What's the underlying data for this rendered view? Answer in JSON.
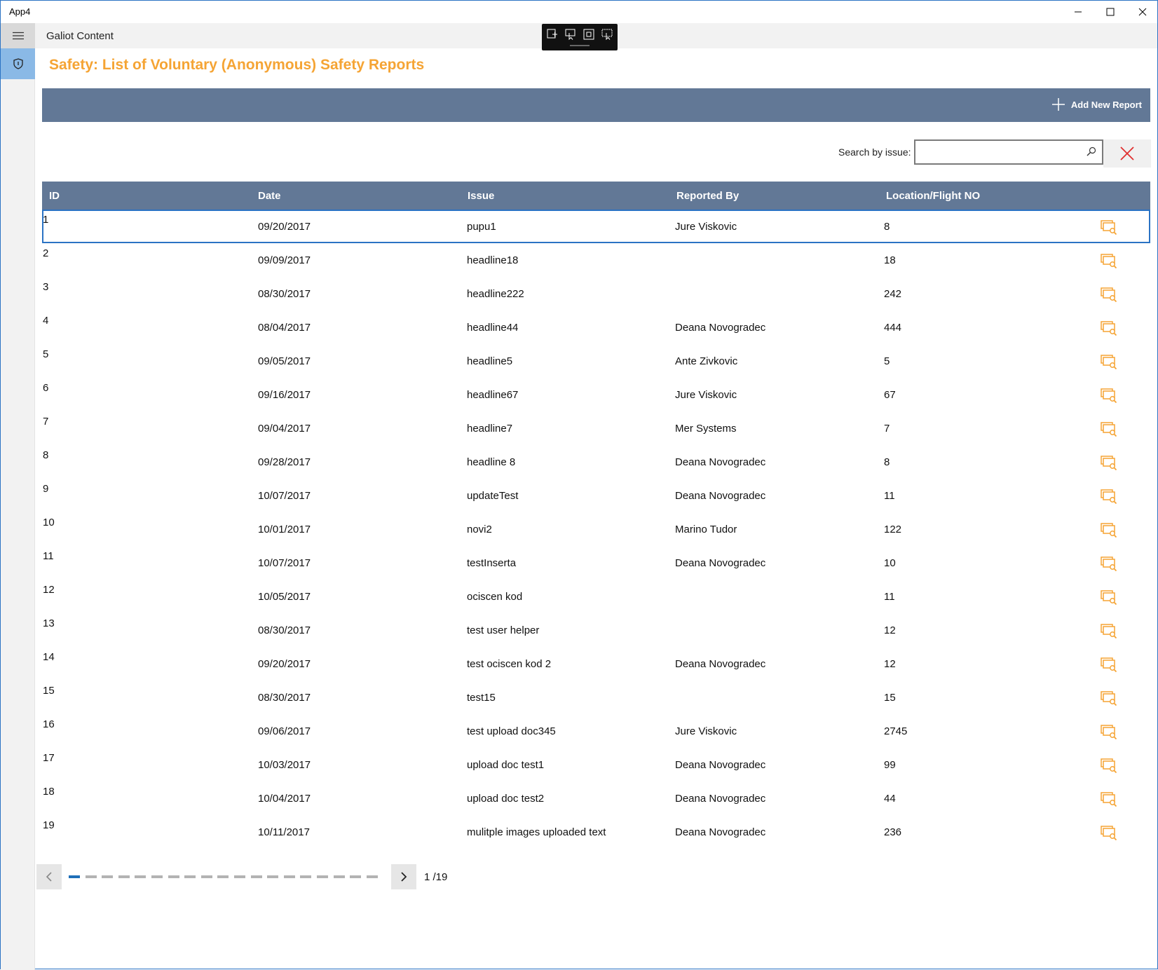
{
  "window": {
    "title": "App4"
  },
  "app": {
    "name": "Galiot Content"
  },
  "page": {
    "title": "Safety: List of Voluntary (Anonymous) Safety Reports"
  },
  "toolbar": {
    "add_label": "Add New Report"
  },
  "search": {
    "label": "Search by issue:",
    "value": ""
  },
  "table": {
    "headers": {
      "id": "ID",
      "date": "Date",
      "issue": "Issue",
      "reported_by": "Reported By",
      "location": "Location/Flight NO"
    },
    "rows": [
      {
        "id": "1",
        "date": "09/20/2017",
        "issue": "pupu1",
        "reported_by": "Jure Viskovic",
        "location": "8"
      },
      {
        "id": "2",
        "date": "09/09/2017",
        "issue": "headline18",
        "reported_by": "",
        "location": "18"
      },
      {
        "id": "3",
        "date": "08/30/2017",
        "issue": "headline222",
        "reported_by": "",
        "location": "242"
      },
      {
        "id": "4",
        "date": "08/04/2017",
        "issue": "headline44",
        "reported_by": "Deana Novogradec",
        "location": "444"
      },
      {
        "id": "5",
        "date": "09/05/2017",
        "issue": "headline5",
        "reported_by": "Ante Zivkovic",
        "location": "5"
      },
      {
        "id": "6",
        "date": "09/16/2017",
        "issue": "headline67",
        "reported_by": "Jure Viskovic",
        "location": "67"
      },
      {
        "id": "7",
        "date": "09/04/2017",
        "issue": "headline7",
        "reported_by": "Mer Systems",
        "location": "7"
      },
      {
        "id": "8",
        "date": "09/28/2017",
        "issue": "headline 8",
        "reported_by": "Deana Novogradec",
        "location": "8"
      },
      {
        "id": "9",
        "date": "10/07/2017",
        "issue": "updateTest",
        "reported_by": "Deana Novogradec",
        "location": "11"
      },
      {
        "id": "10",
        "date": "10/01/2017",
        "issue": "novi2",
        "reported_by": "Marino Tudor",
        "location": "122"
      },
      {
        "id": "11",
        "date": "10/07/2017",
        "issue": "testInserta",
        "reported_by": "Deana Novogradec",
        "location": "10"
      },
      {
        "id": "12",
        "date": "10/05/2017",
        "issue": "ociscen kod",
        "reported_by": "",
        "location": "11"
      },
      {
        "id": "13",
        "date": "08/30/2017",
        "issue": "test user helper",
        "reported_by": "",
        "location": "12"
      },
      {
        "id": "14",
        "date": "09/20/2017",
        "issue": "test ociscen kod 2",
        "reported_by": "Deana Novogradec",
        "location": "12"
      },
      {
        "id": "15",
        "date": "08/30/2017",
        "issue": "test15",
        "reported_by": "",
        "location": "15"
      },
      {
        "id": "16",
        "date": "09/06/2017",
        "issue": "test upload doc345",
        "reported_by": "Jure Viskovic",
        "location": "2745"
      },
      {
        "id": "17",
        "date": "10/03/2017",
        "issue": "upload doc test1",
        "reported_by": "Deana Novogradec",
        "location": "99"
      },
      {
        "id": "18",
        "date": "10/04/2017",
        "issue": "upload doc test2",
        "reported_by": "Deana Novogradec",
        "location": "44"
      },
      {
        "id": "19",
        "date": "10/11/2017",
        "issue": "mulitple images uploaded text",
        "reported_by": "Deana Novogradec",
        "location": "236"
      }
    ],
    "row_action_icon": "view-report-icon",
    "selected_row": 1
  },
  "pager": {
    "label": "1 /19",
    "current_page": 1,
    "total_pages": 19
  },
  "colors": {
    "accent": "#f5a434",
    "header_bg": "#627896",
    "selection": "#2b73c4",
    "rail_active": "#8ab9e6"
  }
}
